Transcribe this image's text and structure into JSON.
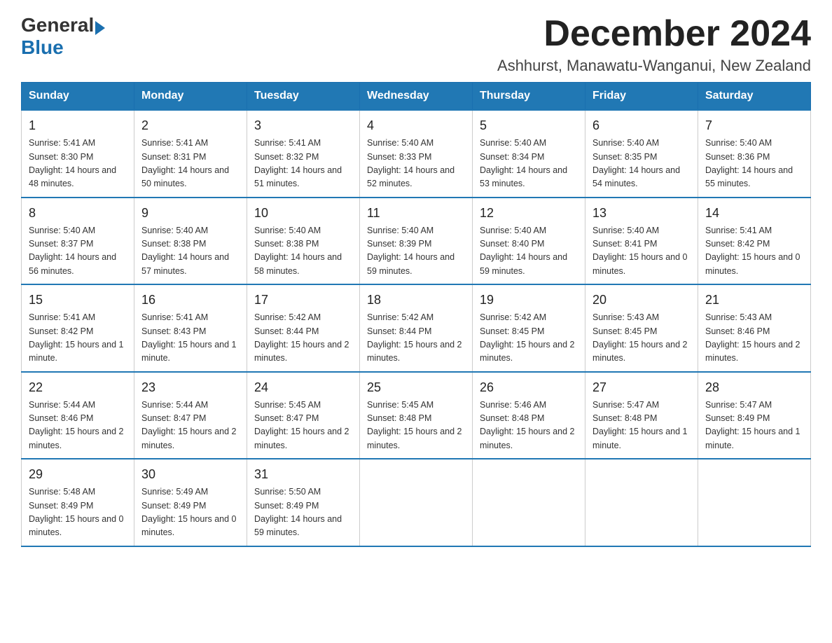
{
  "header": {
    "logo_general": "General",
    "logo_blue": "Blue",
    "month_title": "December 2024",
    "location": "Ashhurst, Manawatu-Wanganui, New Zealand"
  },
  "days_of_week": [
    "Sunday",
    "Monday",
    "Tuesday",
    "Wednesday",
    "Thursday",
    "Friday",
    "Saturday"
  ],
  "weeks": [
    [
      {
        "day": "1",
        "sunrise": "5:41 AM",
        "sunset": "8:30 PM",
        "daylight": "14 hours and 48 minutes."
      },
      {
        "day": "2",
        "sunrise": "5:41 AM",
        "sunset": "8:31 PM",
        "daylight": "14 hours and 50 minutes."
      },
      {
        "day": "3",
        "sunrise": "5:41 AM",
        "sunset": "8:32 PM",
        "daylight": "14 hours and 51 minutes."
      },
      {
        "day": "4",
        "sunrise": "5:40 AM",
        "sunset": "8:33 PM",
        "daylight": "14 hours and 52 minutes."
      },
      {
        "day": "5",
        "sunrise": "5:40 AM",
        "sunset": "8:34 PM",
        "daylight": "14 hours and 53 minutes."
      },
      {
        "day": "6",
        "sunrise": "5:40 AM",
        "sunset": "8:35 PM",
        "daylight": "14 hours and 54 minutes."
      },
      {
        "day": "7",
        "sunrise": "5:40 AM",
        "sunset": "8:36 PM",
        "daylight": "14 hours and 55 minutes."
      }
    ],
    [
      {
        "day": "8",
        "sunrise": "5:40 AM",
        "sunset": "8:37 PM",
        "daylight": "14 hours and 56 minutes."
      },
      {
        "day": "9",
        "sunrise": "5:40 AM",
        "sunset": "8:38 PM",
        "daylight": "14 hours and 57 minutes."
      },
      {
        "day": "10",
        "sunrise": "5:40 AM",
        "sunset": "8:38 PM",
        "daylight": "14 hours and 58 minutes."
      },
      {
        "day": "11",
        "sunrise": "5:40 AM",
        "sunset": "8:39 PM",
        "daylight": "14 hours and 59 minutes."
      },
      {
        "day": "12",
        "sunrise": "5:40 AM",
        "sunset": "8:40 PM",
        "daylight": "14 hours and 59 minutes."
      },
      {
        "day": "13",
        "sunrise": "5:40 AM",
        "sunset": "8:41 PM",
        "daylight": "15 hours and 0 minutes."
      },
      {
        "day": "14",
        "sunrise": "5:41 AM",
        "sunset": "8:42 PM",
        "daylight": "15 hours and 0 minutes."
      }
    ],
    [
      {
        "day": "15",
        "sunrise": "5:41 AM",
        "sunset": "8:42 PM",
        "daylight": "15 hours and 1 minute."
      },
      {
        "day": "16",
        "sunrise": "5:41 AM",
        "sunset": "8:43 PM",
        "daylight": "15 hours and 1 minute."
      },
      {
        "day": "17",
        "sunrise": "5:42 AM",
        "sunset": "8:44 PM",
        "daylight": "15 hours and 2 minutes."
      },
      {
        "day": "18",
        "sunrise": "5:42 AM",
        "sunset": "8:44 PM",
        "daylight": "15 hours and 2 minutes."
      },
      {
        "day": "19",
        "sunrise": "5:42 AM",
        "sunset": "8:45 PM",
        "daylight": "15 hours and 2 minutes."
      },
      {
        "day": "20",
        "sunrise": "5:43 AM",
        "sunset": "8:45 PM",
        "daylight": "15 hours and 2 minutes."
      },
      {
        "day": "21",
        "sunrise": "5:43 AM",
        "sunset": "8:46 PM",
        "daylight": "15 hours and 2 minutes."
      }
    ],
    [
      {
        "day": "22",
        "sunrise": "5:44 AM",
        "sunset": "8:46 PM",
        "daylight": "15 hours and 2 minutes."
      },
      {
        "day": "23",
        "sunrise": "5:44 AM",
        "sunset": "8:47 PM",
        "daylight": "15 hours and 2 minutes."
      },
      {
        "day": "24",
        "sunrise": "5:45 AM",
        "sunset": "8:47 PM",
        "daylight": "15 hours and 2 minutes."
      },
      {
        "day": "25",
        "sunrise": "5:45 AM",
        "sunset": "8:48 PM",
        "daylight": "15 hours and 2 minutes."
      },
      {
        "day": "26",
        "sunrise": "5:46 AM",
        "sunset": "8:48 PM",
        "daylight": "15 hours and 2 minutes."
      },
      {
        "day": "27",
        "sunrise": "5:47 AM",
        "sunset": "8:48 PM",
        "daylight": "15 hours and 1 minute."
      },
      {
        "day": "28",
        "sunrise": "5:47 AM",
        "sunset": "8:49 PM",
        "daylight": "15 hours and 1 minute."
      }
    ],
    [
      {
        "day": "29",
        "sunrise": "5:48 AM",
        "sunset": "8:49 PM",
        "daylight": "15 hours and 0 minutes."
      },
      {
        "day": "30",
        "sunrise": "5:49 AM",
        "sunset": "8:49 PM",
        "daylight": "15 hours and 0 minutes."
      },
      {
        "day": "31",
        "sunrise": "5:50 AM",
        "sunset": "8:49 PM",
        "daylight": "14 hours and 59 minutes."
      },
      null,
      null,
      null,
      null
    ]
  ]
}
